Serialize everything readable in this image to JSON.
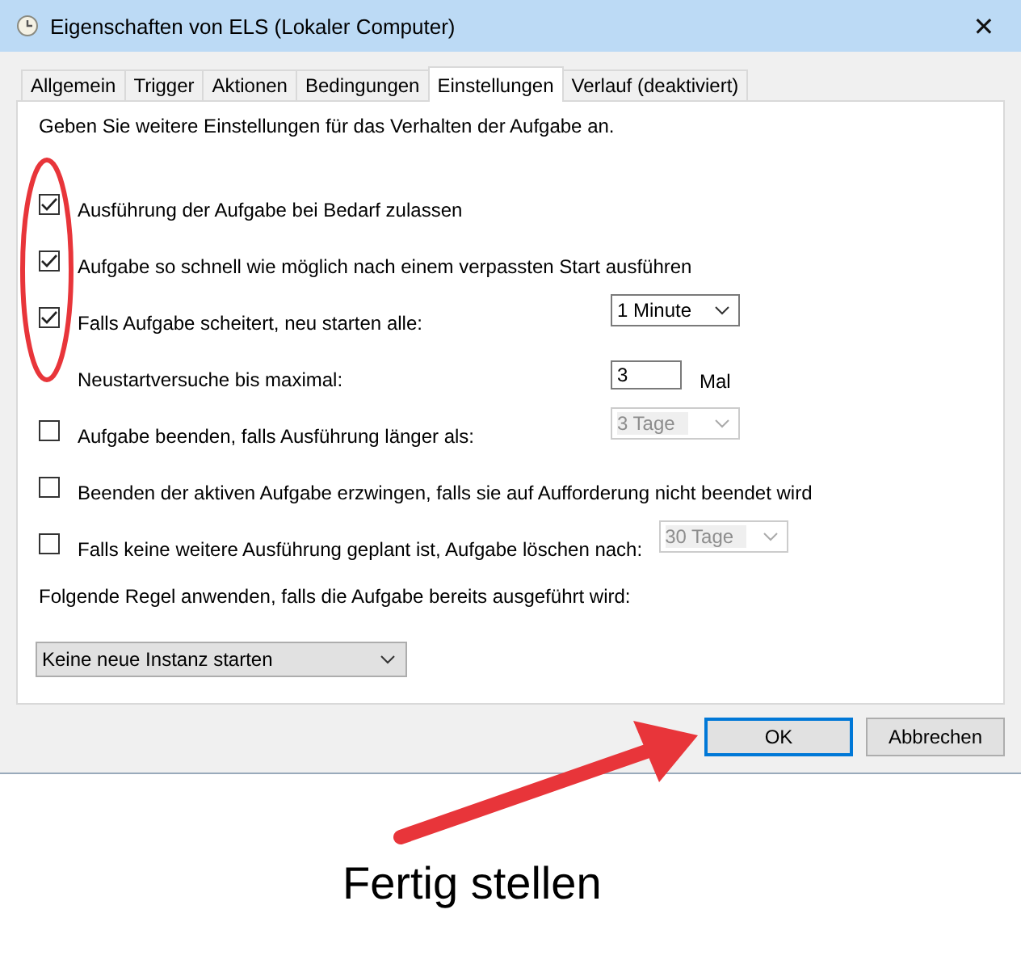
{
  "window": {
    "title": "Eigenschaften von ELS (Lokaler Computer)",
    "close": "✕"
  },
  "tabs": [
    {
      "label": "Allgemein",
      "selected": false
    },
    {
      "label": "Trigger",
      "selected": false
    },
    {
      "label": "Aktionen",
      "selected": false
    },
    {
      "label": "Bedingungen",
      "selected": false
    },
    {
      "label": "Einstellungen",
      "selected": true
    },
    {
      "label": "Verlauf (deaktiviert)",
      "selected": false
    }
  ],
  "intro": "Geben Sie weitere Einstellungen für das Verhalten der Aufgabe an.",
  "settings": [
    {
      "kind": "checkbox",
      "label": "Ausführung der Aufgabe bei Bedarf zulassen",
      "checked": true
    },
    {
      "kind": "checkbox",
      "label": "Aufgabe so schnell wie möglich nach einem verpassten Start ausführen",
      "checked": true
    },
    {
      "kind": "checkbox",
      "label": "Falls Aufgabe scheitert, neu starten alle:",
      "checked": true,
      "dropdown": {
        "value": "1 Minute",
        "disabled": false
      }
    },
    {
      "kind": "number",
      "label": "Neustartversuche bis maximal:",
      "value": "3",
      "unit": "Mal"
    },
    {
      "kind": "checkbox",
      "label": "Aufgabe beenden, falls Ausführung länger als:",
      "checked": false,
      "dropdown": {
        "value": "3 Tage",
        "disabled": true
      }
    },
    {
      "kind": "checkbox",
      "label": "Beenden der aktiven Aufgabe erzwingen, falls sie auf Aufforderung nicht beendet wird",
      "checked": false
    },
    {
      "kind": "checkbox",
      "label": "Falls keine weitere Ausführung geplant ist, Aufgabe löschen nach:",
      "checked": false,
      "dropdown": {
        "value": "30 Tage",
        "disabled": true
      }
    }
  ],
  "rule": {
    "label": "Folgende Regel anwenden, falls die Aufgabe bereits ausgeführt wird:",
    "value": "Keine neue Instanz starten"
  },
  "buttons": [
    {
      "label": "OK",
      "selected": true
    },
    {
      "label": "Abbrechen",
      "selected": false
    }
  ],
  "annotation": {
    "caption": "Fertig stellen"
  }
}
